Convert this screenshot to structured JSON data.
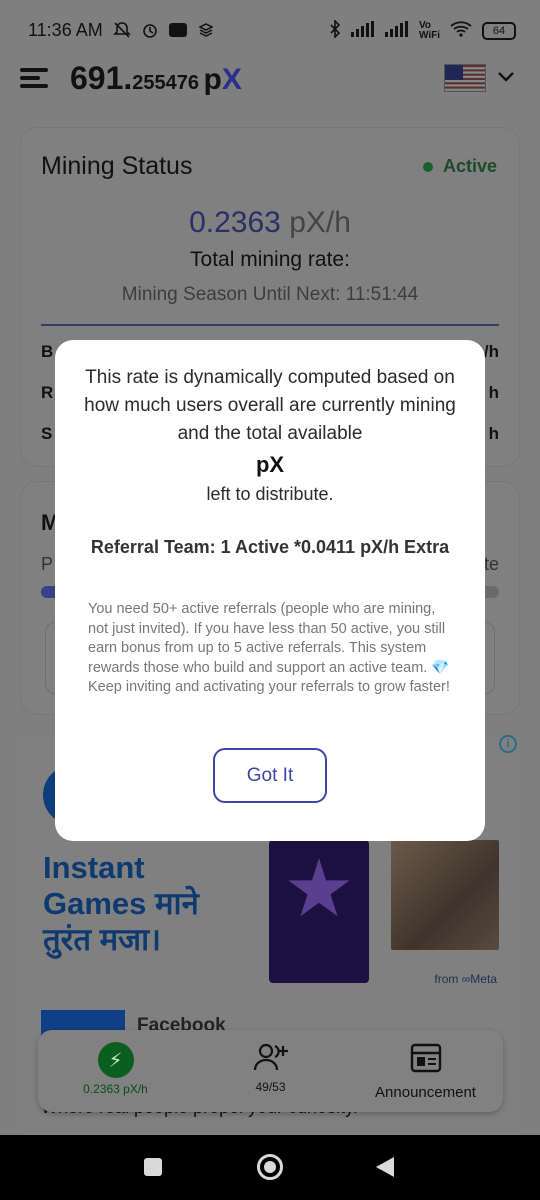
{
  "status_bar": {
    "time": "11:36 AM",
    "icons": [
      "mute-icon",
      "alarm-icon",
      "paytm-icon",
      "stack-icon"
    ],
    "right_icons": [
      "bluetooth-icon",
      "signal-icon",
      "signal-icon",
      "vowifi-icon",
      "wifi-icon"
    ],
    "vowifi": "Vo\nWiFi",
    "battery": "64"
  },
  "header": {
    "balance_int": "691.",
    "balance_dec": "255476",
    "unit_p": "p",
    "unit_x": "X",
    "flag": "us-flag-icon"
  },
  "mining_status": {
    "title": "Mining Status",
    "status": "Active",
    "rate_value": "0.2363",
    "rate_unit": "pX/h",
    "total_label": "Total mining rate:",
    "season": "Mining Season Until Next: 11:51:44",
    "rows": [
      {
        "left": "B",
        "right": "/h"
      },
      {
        "left": "R",
        "right": "h"
      },
      {
        "left": "S",
        "right": "h"
      }
    ]
  },
  "card2": {
    "title": "M",
    "left": "P",
    "right": "te",
    "progress": 0.05
  },
  "ad": {
    "info": "i",
    "headline": "Instant\nGames माने\nतुरंत मजा।",
    "meta": "from ∞Meta",
    "advertiser": "Facebook",
    "tagline": "Where real people propel your curiosity."
  },
  "modal": {
    "text1": "This rate is dynamically computed based on how much users overall are currently mining and the total available",
    "px": "pX",
    "text2": "left to distribute.",
    "referral": "Referral Team: 1 Active *0.0411 pX/h Extra",
    "info": "You need 50+ active referrals (people who are mining, not just invited). If you have less than 50 active, you still earn bonus from up to 5 active referrals. This system rewards those who build and support an active team. 💎 Keep inviting and activating your referrals to grow faster!",
    "button": "Got It"
  },
  "bottom_nav": {
    "rate": "0.2363 pX/h",
    "referrals": "49/53",
    "announcement": "Announcement"
  },
  "colors": {
    "accent": "#3e44a8",
    "active_green": "#1c5f2e",
    "overlay_gray": "#7f7f7f"
  }
}
